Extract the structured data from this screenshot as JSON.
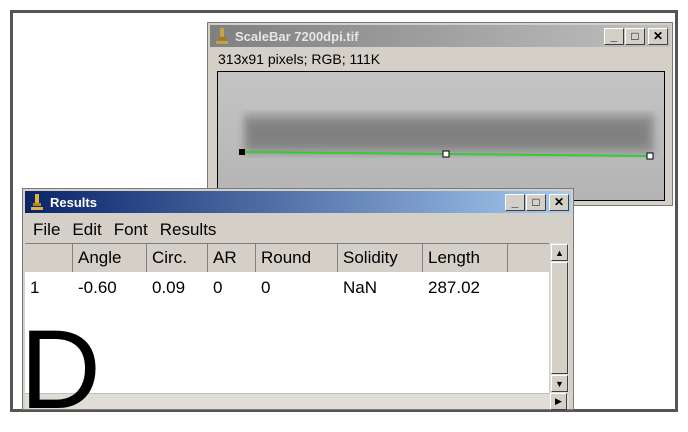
{
  "panel_label": "D",
  "scalebar_window": {
    "title": "ScaleBar 7200dpi.tif",
    "info": "313x91 pixels; RGB; 111K",
    "buttons": {
      "minimize": "_",
      "maximize": "□",
      "close": "✕"
    }
  },
  "results_window": {
    "title": "Results",
    "menu": [
      "File",
      "Edit",
      "Font",
      "Results"
    ],
    "columns": [
      "",
      "Angle",
      "Circ.",
      "AR",
      "Round",
      "Solidity",
      "Length"
    ],
    "rows": [
      [
        "1",
        "-0.60",
        "0.09",
        "0",
        "0",
        "NaN",
        "287.02"
      ]
    ],
    "buttons": {
      "minimize": "_",
      "maximize": "□",
      "close": "✕"
    }
  },
  "colors": {
    "line_selection": "#33cc33",
    "active_title": "#0a246a",
    "inactive_title": "#808080"
  }
}
